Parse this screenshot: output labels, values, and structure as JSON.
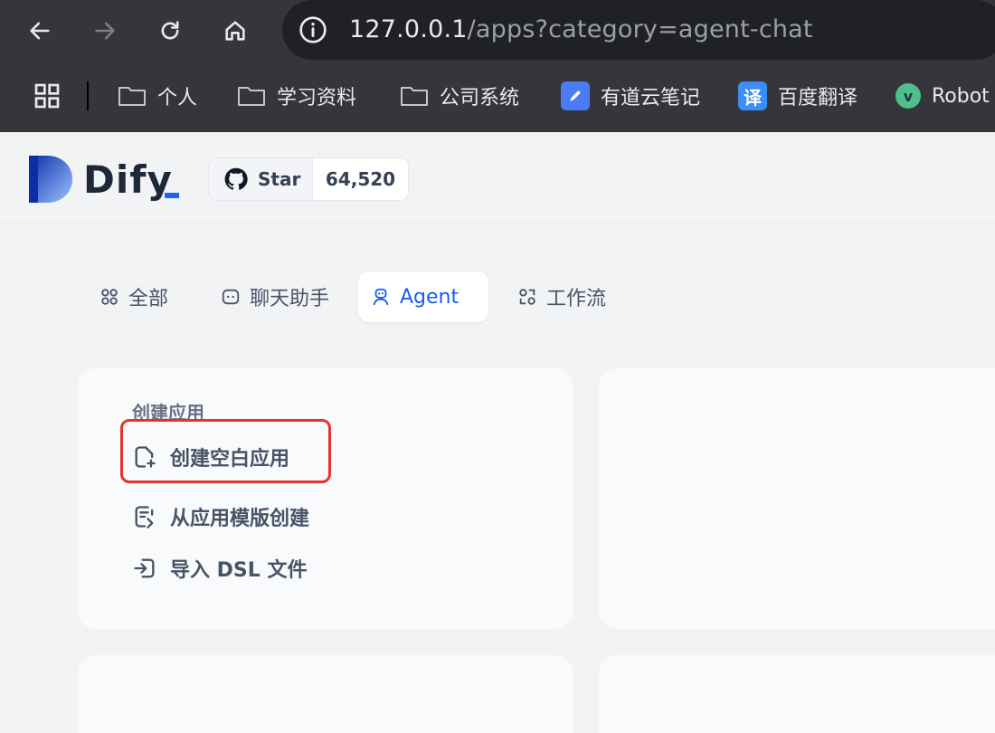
{
  "browser": {
    "url_host": "127.0.0.1",
    "url_path": "/apps?category=agent-chat",
    "bookmarks": [
      {
        "label": "个人",
        "icon": "folder-icon"
      },
      {
        "label": "学习资料",
        "icon": "folder-icon"
      },
      {
        "label": "公司系统",
        "icon": "folder-icon"
      },
      {
        "label": "有道云笔记",
        "icon": "youdao-note-icon"
      },
      {
        "label": "百度翻译",
        "icon": "baidu-translate-icon"
      },
      {
        "label": "Robot",
        "icon": "robot-icon"
      }
    ],
    "baidu_icon_glyph": "译",
    "robot_icon_glyph": "v"
  },
  "header": {
    "brand": "Dify",
    "github": {
      "star_label": "Star",
      "star_count": "64,520"
    }
  },
  "tabs": [
    {
      "label": "全部",
      "icon": "grid-icon",
      "active": false
    },
    {
      "label": "聊天助手",
      "icon": "chat-icon",
      "active": false
    },
    {
      "label": "Agent",
      "icon": "robot-icon",
      "active": true
    },
    {
      "label": "工作流",
      "icon": "workflow-icon",
      "active": false
    }
  ],
  "create_card": {
    "title": "创建应用",
    "items": [
      {
        "label": "创建空白应用",
        "icon": "file-plus-icon"
      },
      {
        "label": "从应用模版创建",
        "icon": "file-template-icon"
      },
      {
        "label": "导入 DSL 文件",
        "icon": "file-import-icon"
      }
    ]
  },
  "colors": {
    "accent": "#155eef",
    "highlight": "#e5322d",
    "chrome": "#35363a"
  }
}
